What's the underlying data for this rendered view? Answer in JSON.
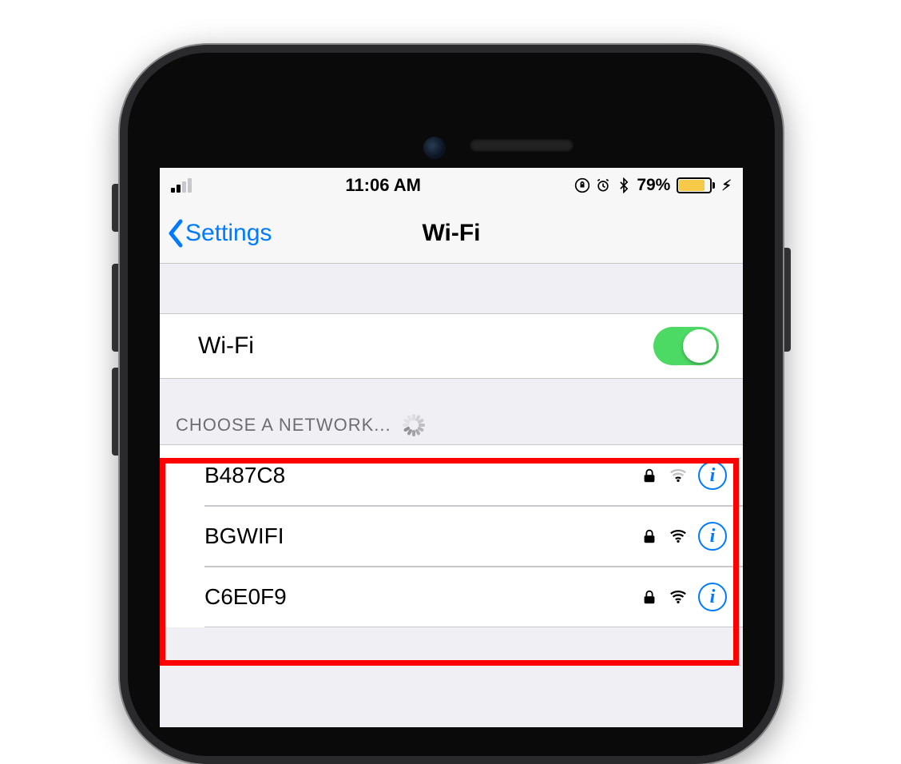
{
  "status_bar": {
    "time": "11:06 AM",
    "battery_pct": "79%",
    "signal_bars_active": 2
  },
  "nav": {
    "back_label": "Settings",
    "title": "Wi-Fi"
  },
  "wifi_toggle": {
    "label": "Wi-Fi",
    "on": true
  },
  "section_header": "CHOOSE A NETWORK...",
  "networks": [
    {
      "name": "B487C8",
      "locked": true,
      "signal": "weak"
    },
    {
      "name": "BGWIFI",
      "locked": true,
      "signal": "strong"
    },
    {
      "name": "C6E0F9",
      "locked": true,
      "signal": "strong"
    }
  ],
  "info_glyph": "i"
}
